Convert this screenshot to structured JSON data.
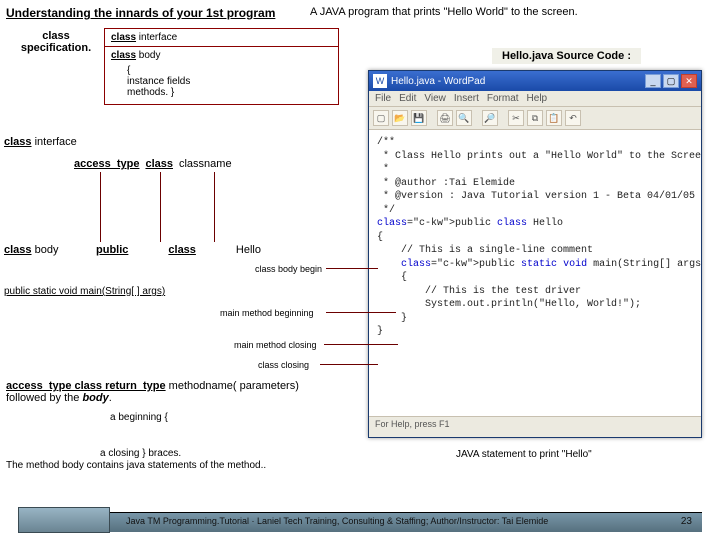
{
  "title": "Understanding the innards of your 1st program",
  "subtitle": "A JAVA program that prints \"Hello World\" to the screen.",
  "spec_label": "class specification.",
  "spec": {
    "row1_kw": "class",
    "row1_txt": " interface",
    "row2_kw": "class",
    "row2_txt": " body",
    "row3": "{\ninstance fields\nmethods. }"
  },
  "src_label": "Hello.java Source Code :",
  "wordpad": {
    "title": "Hello.java - WordPad",
    "menu": [
      "File",
      "Edit",
      "View",
      "Insert",
      "Format",
      "Help"
    ],
    "status": "For Help, press F1",
    "code_lines": [
      "/**",
      " * Class Hello prints out a \"Hello World\" to the Screen.",
      " *",
      " * @author :Tai Elemide",
      " * @version : Java Tutorial version 1 - Beta 04/01/05",
      " */",
      "public class Hello",
      "{",
      "    // This is a single-line comment",
      "    public static void main(String[] args)",
      "    {",
      "        // This is the test driver",
      "        System.out.println(\"Hello, World!\");",
      "    }",
      "}"
    ]
  },
  "left": {
    "ci_kw": "class",
    "ci_txt": " interface",
    "pattern": {
      "p1": "access_type",
      "p2": "class",
      "p3": "classname"
    },
    "cb_kw": "class",
    "cb_txt": " body",
    "pub": "public",
    "cls": "class",
    "hello": "Hello"
  },
  "labels": {
    "class_body_begin": "class body begin",
    "main_line": "public static void main(String[ ] args)",
    "main_begin": "main method beginning",
    "main_close": "main method closing",
    "class_close": "class  closing"
  },
  "method_pattern": {
    "p": "access_type class return_type",
    "rest": " methodname( parameters) followed by the ",
    "body": "body",
    "dot": "."
  },
  "beg_brace": "a  beginning   {",
  "close_brace": "a closing  }  braces.",
  "body_note": "The method body contains java statements of the method..",
  "java_stmt": "JAVA statement to print \"Hello\"",
  "footer": "Java TM Programming.Tutorial  ·  Laniel Tech Training, Consulting & Staffing; Author/Instructor: Tai Elemide",
  "page": "23"
}
